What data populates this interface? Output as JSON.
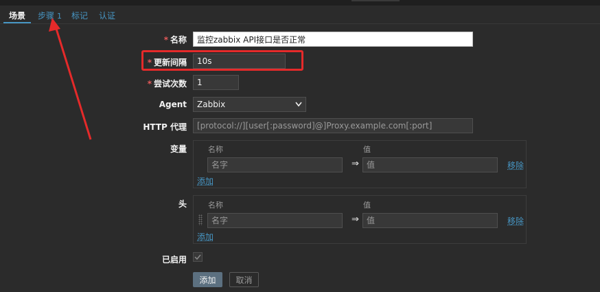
{
  "tabs": [
    {
      "label": "场景"
    },
    {
      "label": "步骤",
      "count": "1"
    },
    {
      "label": "标记"
    },
    {
      "label": "认证"
    }
  ],
  "form": {
    "name": {
      "label": "名称",
      "value": "监控zabbix API接口是否正常"
    },
    "update_interval": {
      "label": "更新间隔",
      "value": "10s"
    },
    "attempts": {
      "label": "尝试次数",
      "value": "1"
    },
    "agent": {
      "label": "Agent",
      "value": "Zabbix"
    },
    "http_proxy": {
      "label": "HTTP 代理",
      "placeholder": "[protocol://][user[:password]@]Proxy.example.com[:port]"
    },
    "variables": {
      "label": "变量",
      "col_name": "名称",
      "col_value": "值",
      "name_placeholder": "名字",
      "value_placeholder": "值",
      "arrow": "⇒",
      "remove": "移除",
      "add": "添加"
    },
    "headers": {
      "label": "头",
      "col_name": "名称",
      "col_value": "值",
      "name_placeholder": "名字",
      "value_placeholder": "值",
      "arrow": "⇒",
      "remove": "移除",
      "add": "添加"
    },
    "enabled": {
      "label": "已启用",
      "checked": true
    }
  },
  "buttons": {
    "add": "添加",
    "cancel": "取消"
  },
  "colors": {
    "accent": "#4796c4",
    "required": "#e45959",
    "annotation": "#e52a2a"
  }
}
